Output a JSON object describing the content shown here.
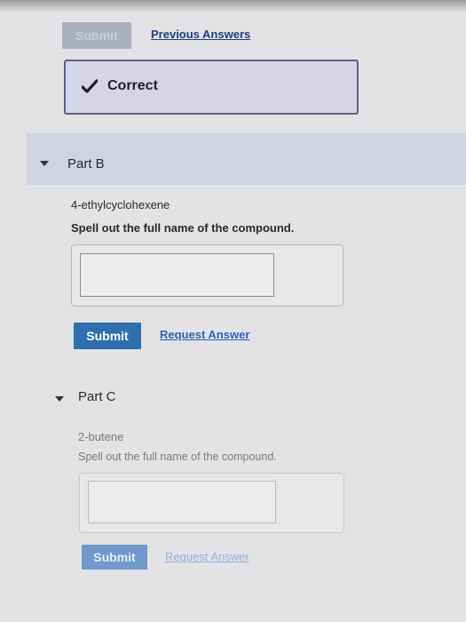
{
  "top": {
    "submit_label": "Submit",
    "previous_answers_label": "Previous Answers",
    "feedback_text": "Correct",
    "feedback_icon": "checkmark-icon"
  },
  "part_b": {
    "title": "Part B",
    "compound": "4-ethylcyclohexene",
    "instruction": "Spell out the full name of the compound.",
    "answer_value": "",
    "submit_label": "Submit",
    "request_answer_label": "Request Answer"
  },
  "part_c": {
    "title": "Part C",
    "compound": "2-butene",
    "instruction": "Spell out the full name of the compound.",
    "answer_value": "",
    "submit_label": "Submit",
    "request_answer_label": "Request Answer"
  },
  "colors": {
    "primary_button": "#2f6fb0",
    "disabled_button": "#a9b0bf",
    "link": "#2e62b3",
    "correct_border": "#5b5f85",
    "correct_bg": "#d5d5e6"
  }
}
